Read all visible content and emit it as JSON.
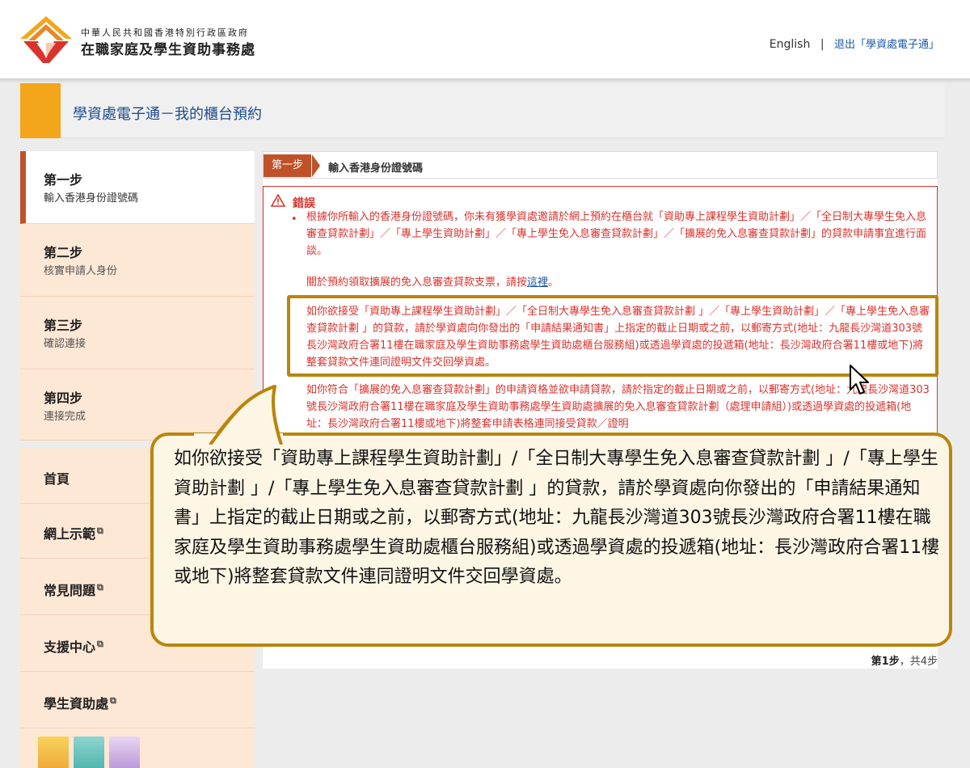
{
  "header": {
    "org_sub": "中華人民共和國香港特別行政區政府",
    "org_main": "在職家庭及學生資助事務處",
    "lang_link": "English",
    "separator": "|",
    "logout_link": "退出「學資處電子通」"
  },
  "title_bar": {
    "title": "學資處電子通－我的櫃台預約"
  },
  "steps": [
    {
      "num": "第一步",
      "sub": "輸入香港身份證號碼",
      "active": true
    },
    {
      "num": "第二步",
      "sub": "核實申請人身份",
      "active": false
    },
    {
      "num": "第三步",
      "sub": "確認連接",
      "active": false
    },
    {
      "num": "第四步",
      "sub": "連接完成",
      "active": false
    }
  ],
  "nav": [
    {
      "label": "首頁",
      "external": false
    },
    {
      "label": "網上示範",
      "external": true
    },
    {
      "label": "常見問題",
      "external": true
    },
    {
      "label": "支援中心",
      "external": true
    },
    {
      "label": "學生資助處",
      "external": true
    }
  ],
  "main": {
    "step_tag": "第一步",
    "step_title": "輸入香港身份證號碼",
    "error": {
      "title": "錯誤",
      "bullet": "•",
      "p1": "根據你所輸入的香港身份證號碼，你未有獲學資處邀請於網上預約在櫃台就「資助專上課程學生資助計劃」／「全日制大專學生免入息審查貸款計劃」／「專上學生資助計劃」／「專上學生免入息審查貸款計劃」／「擴展的免入息審查貸款計劃」的貸款申請事宜進行面談。",
      "p2_before": "關於預約領取擴展的免入息審查貸款支票，請按",
      "p2_link": "這裡",
      "p2_after": "。",
      "p3": "如你欲接受「資助專上課程學生資助計劃」／「全日制大專學生免入息審查貸款計劃 」／「專上學生資助計劃」／「專上學生免入息審查貸款計劃 」的貸款，請於學資處向你發出的「申請結果通知書」上指定的截止日期或之前，以郵寄方式(地址：九龍長沙灣道303號長沙灣政府合署11樓在職家庭及學生資助事務處學生資助處櫃台服務組)或透過學資處的投遞箱(地址：長沙灣政府合署11樓或地下)將整套貸款文件連同證明文件交回學資處。",
      "p4": "如你符合「擴展的免入息審查貸款計劃」的申請資格並欲申請貸款，請於指定的截止日期或之前，以郵寄方式(地址：九龍長沙灣道303號長沙灣政府合署11樓在職家庭及學生資助事務處學生資助處擴展的免入息審查貸款計劃（處理申請組）)或透過學資處的投遞箱(地址：長沙灣政府合署11樓或地下)將整套申請表格連同接受貸款／證明"
    },
    "page_count_bold": "第1步",
    "page_count_rest": "，共4步"
  },
  "callout": {
    "text": "如你欲接受「資助專上課程學生資助計劃」/「全日制大專學生免入息審查貸款計劃 」/「專上學生資助計劃 」/「專上學生免入息審查貸款計劃 」的貸款，請於學資處向你發出的「申請結果通知書」上指定的截止日期或之前，以郵寄方式(地址：九龍長沙灣道303號長沙灣政府合署11樓在職家庭及學生資助事務處學生資助處櫃台服務組)或透過學資處的投遞箱(地址：長沙灣政府合署11樓或地下)將整套貸款文件連同證明文件交回學資處。"
  },
  "colors": {
    "accent_orange": "#f3a61a",
    "step_red": "#c0522a",
    "error_red": "#d9332e",
    "highlight_gold": "#b8860b",
    "link_blue": "#1a5aa8"
  },
  "icons": {
    "logo": "sfao-logo",
    "error": "warning-triangle-icon",
    "external": "external-link-icon",
    "cursor": "mouse-pointer-icon"
  }
}
